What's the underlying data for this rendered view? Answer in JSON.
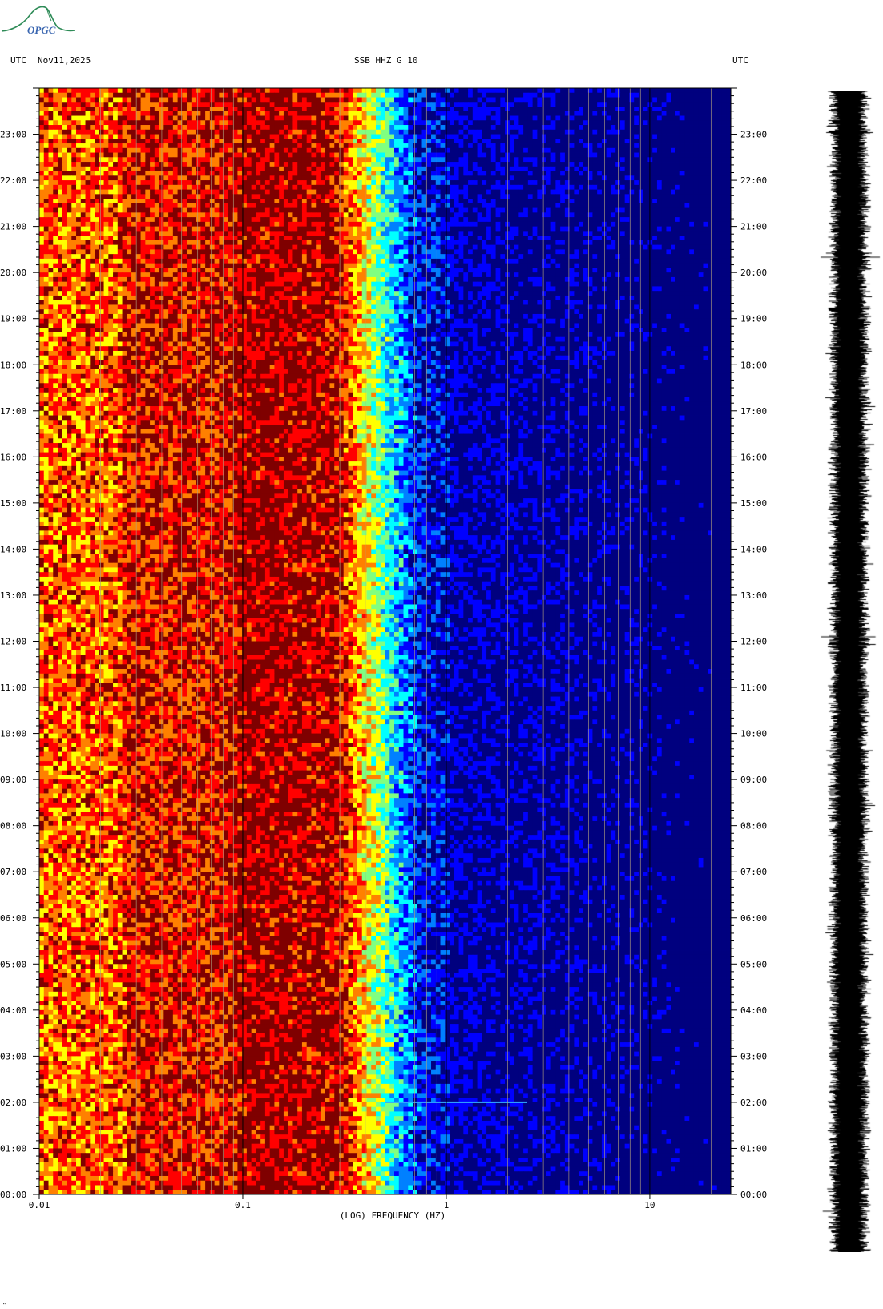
{
  "logo": {
    "text": "OPGC",
    "colors": {
      "arc": "#2e8b57",
      "text": "#3a66b0"
    }
  },
  "header": {
    "left_tz": "UTC",
    "date": "Nov11,2025",
    "station": "SSB HHZ G 10",
    "right_tz": "UTC"
  },
  "footnote": "\"",
  "chart_data": {
    "type": "heatmap",
    "title": "SSB HHZ G 10",
    "xlabel": "(LOG) FREQUENCY (HZ)",
    "x_scale": "log",
    "xlim": [
      0.01,
      25
    ],
    "x_ticks": [
      {
        "value": 0.01,
        "label": "0.01"
      },
      {
        "value": 0.1,
        "label": "0.1"
      },
      {
        "value": 1,
        "label": "1"
      },
      {
        "value": 10,
        "label": "10"
      }
    ],
    "ylabel": "UTC",
    "ylim_hours": [
      0,
      24
    ],
    "y_ticks": [
      "00:00",
      "01:00",
      "02:00",
      "03:00",
      "04:00",
      "05:00",
      "06:00",
      "07:00",
      "08:00",
      "09:00",
      "10:00",
      "11:00",
      "12:00",
      "13:00",
      "14:00",
      "15:00",
      "16:00",
      "17:00",
      "18:00",
      "19:00",
      "20:00",
      "21:00",
      "22:00",
      "23:00"
    ],
    "grid_frequencies_hz": [
      0.02,
      0.03,
      0.04,
      0.05,
      0.06,
      0.07,
      0.08,
      0.09,
      0.2,
      0.3,
      0.4,
      0.5,
      0.6,
      0.7,
      0.8,
      0.9,
      2,
      3,
      4,
      5,
      6,
      7,
      8,
      9,
      20
    ],
    "energy_profile": {
      "description": "relative spectral power vs frequency (0 = low, 1 = high)",
      "points": [
        {
          "f": 0.01,
          "p": 0.8
        },
        {
          "f": 0.024,
          "p": 0.8
        },
        {
          "f": 0.025,
          "p": 0.9
        },
        {
          "f": 0.07,
          "p": 0.9
        },
        {
          "f": 0.1,
          "p": 0.98
        },
        {
          "f": 0.27,
          "p": 0.95
        },
        {
          "f": 0.35,
          "p": 0.72
        },
        {
          "f": 0.45,
          "p": 0.5
        },
        {
          "f": 0.55,
          "p": 0.3
        },
        {
          "f": 0.7,
          "p": 0.12
        },
        {
          "f": 1,
          "p": 0.06
        },
        {
          "f": 25,
          "p": 0.03
        }
      ]
    },
    "events": [
      {
        "time": "02:00",
        "frequency_range_hz": [
          0.5,
          2.5
        ],
        "note": "short high-frequency signal"
      }
    ],
    "colormap": [
      "#00007f",
      "#0000ff",
      "#0080ff",
      "#00ffff",
      "#80ff80",
      "#ffff00",
      "#ff8000",
      "#ff0000",
      "#7f0000"
    ],
    "seismogram": {
      "label": "",
      "color": "#000000"
    }
  }
}
